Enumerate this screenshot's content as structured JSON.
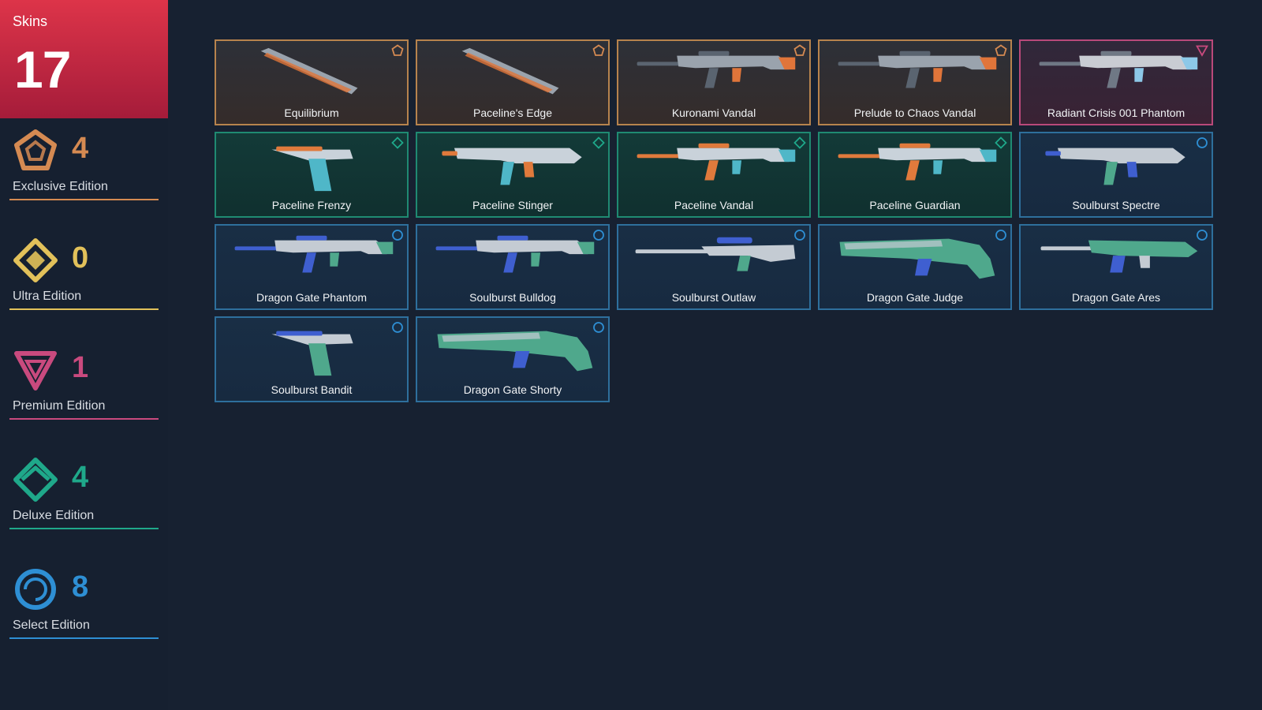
{
  "total": {
    "label": "Skins",
    "count": "17"
  },
  "tiers": [
    {
      "key": "exclusive",
      "name": "Exclusive Edition",
      "count": "4",
      "color": "#d58a52",
      "icon": "exclusive-edition-icon"
    },
    {
      "key": "ultra",
      "name": "Ultra Edition",
      "count": "0",
      "color": "#e2c15a",
      "icon": "ultra-edition-icon"
    },
    {
      "key": "premium",
      "name": "Premium Edition",
      "count": "1",
      "color": "#c94a7e",
      "icon": "premium-edition-icon"
    },
    {
      "key": "deluxe",
      "name": "Deluxe Edition",
      "count": "4",
      "color": "#1fa88a",
      "icon": "deluxe-edition-icon"
    },
    {
      "key": "select",
      "name": "Select Edition",
      "count": "8",
      "color": "#2e8fd4",
      "icon": "select-edition-icon"
    }
  ],
  "skins": [
    {
      "name": "Equilibrium",
      "tier": "exclusive",
      "weapon": "melee"
    },
    {
      "name": "Paceline's Edge",
      "tier": "exclusive",
      "weapon": "melee"
    },
    {
      "name": "Kuronami Vandal",
      "tier": "exclusive",
      "weapon": "rifle"
    },
    {
      "name": "Prelude to Chaos Vandal",
      "tier": "exclusive",
      "weapon": "rifle"
    },
    {
      "name": "Radiant Crisis 001 Phantom",
      "tier": "premium",
      "weapon": "rifle"
    },
    {
      "name": "Paceline Frenzy",
      "tier": "deluxe",
      "weapon": "pistol"
    },
    {
      "name": "Paceline Stinger",
      "tier": "deluxe",
      "weapon": "smg"
    },
    {
      "name": "Paceline Vandal",
      "tier": "deluxe",
      "weapon": "rifle"
    },
    {
      "name": "Paceline Guardian",
      "tier": "deluxe",
      "weapon": "rifle"
    },
    {
      "name": "Soulburst Spectre",
      "tier": "select",
      "weapon": "smg"
    },
    {
      "name": "Dragon Gate Phantom",
      "tier": "select",
      "weapon": "rifle"
    },
    {
      "name": "Soulburst Bulldog",
      "tier": "select",
      "weapon": "rifle"
    },
    {
      "name": "Soulburst Outlaw",
      "tier": "select",
      "weapon": "sniper"
    },
    {
      "name": "Dragon Gate Judge",
      "tier": "select",
      "weapon": "shotgun"
    },
    {
      "name": "Dragon Gate Ares",
      "tier": "select",
      "weapon": "lmg"
    },
    {
      "name": "Soulburst Bandit",
      "tier": "select",
      "weapon": "pistol"
    },
    {
      "name": "Dragon Gate Shorty",
      "tier": "select",
      "weapon": "shotgun"
    }
  ]
}
